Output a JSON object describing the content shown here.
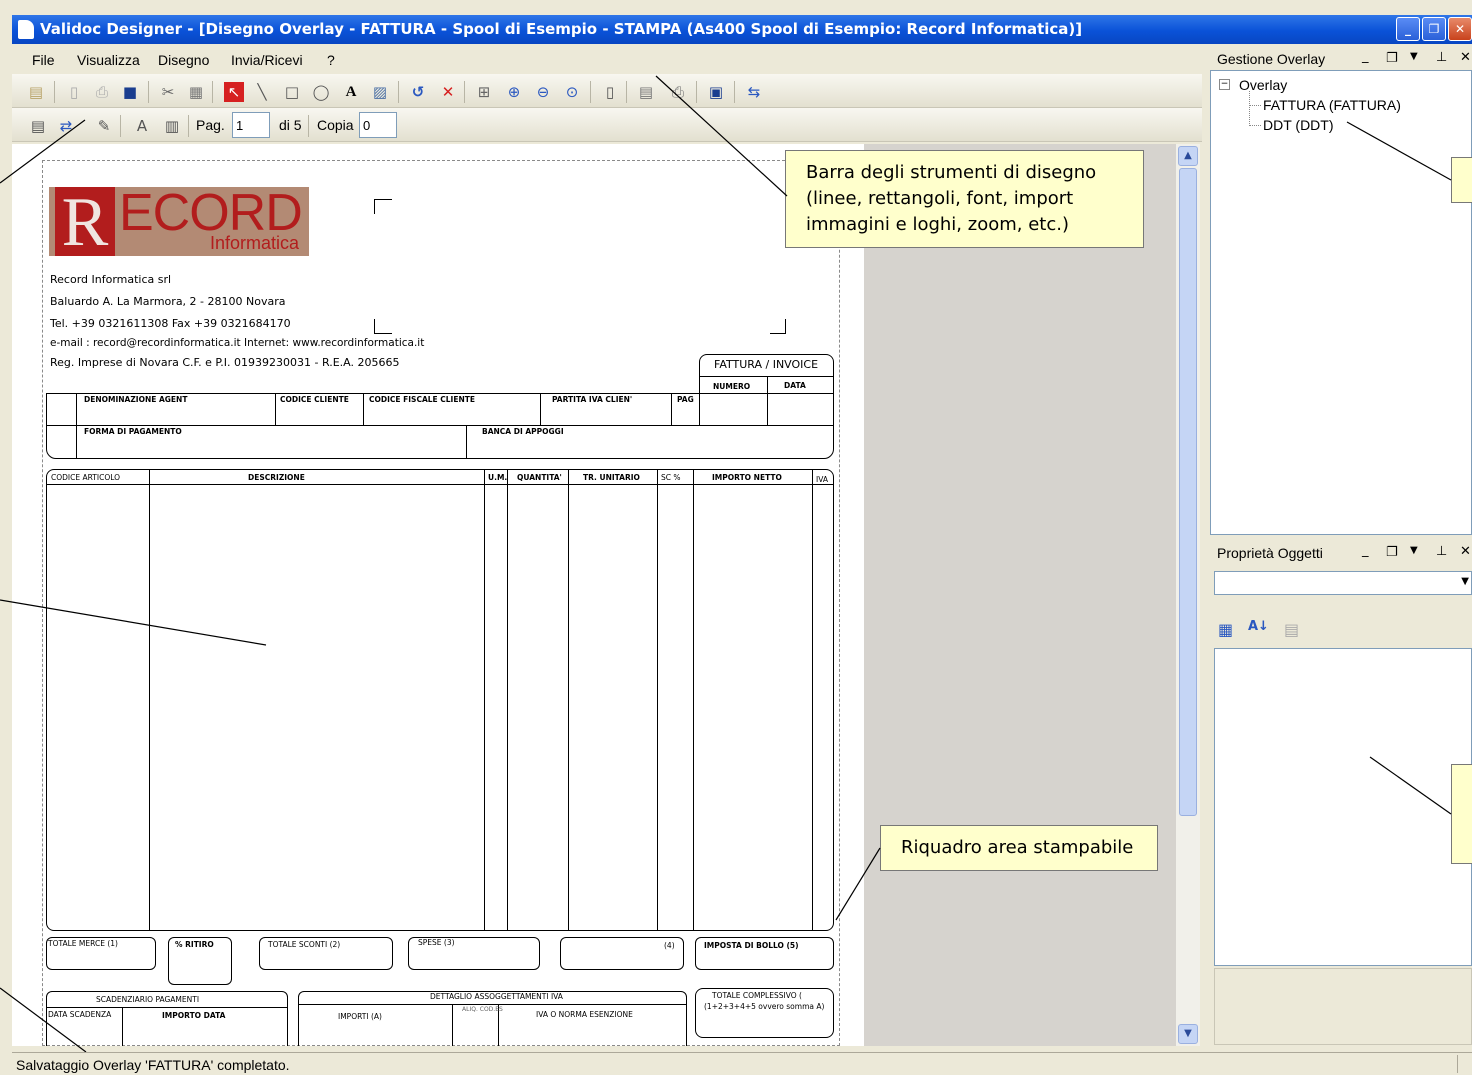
{
  "window": {
    "title": "Validoc Designer - [Disegno Overlay - FATTURA - Spool di Esempio - STAMPA (As400 Spool di Esempio: Record Informatica)]"
  },
  "menu": [
    "File",
    "Visualizza",
    "Disegno",
    "Invia/Ricevi",
    "?"
  ],
  "toolbar2": {
    "page_label": "Pag.",
    "page_value": "1",
    "of_label": "di 5",
    "copy_label": "Copia",
    "copy_value": "0"
  },
  "document": {
    "logo_r": "R",
    "logo_main": "ECORD",
    "logo_sub": "Informatica",
    "address": [
      "Record Informatica srl",
      "Baluardo A. La Marmora, 2 - 28100 Novara",
      "Tel. +39 0321611308 Fax +39 0321684170",
      "e-mail : record@recordinformatica.it Internet: www.recordinformatica.it",
      "Reg. Imprese di Novara C.F. e P.I. 01939230031 - R.E.A. 205665"
    ],
    "invoice_title": "FATTURA / INVOICE",
    "numero": "NUMERO",
    "data": "DATA",
    "denominazione": "DENOMINAZIONE AGENT",
    "codice_cliente": "CODICE CLIENTE",
    "codice_fiscale": "CODICE FISCALE CLIENTE",
    "partita_iva": "PARTITA IVA CLIEN'",
    "pag": "PAG",
    "forma_pagamento": "FORMA DI PAGAMENTO",
    "banca": "BANCA DI APPOGGI",
    "cols": [
      "CODICE ARTICOLO",
      "DESCRIZIONE",
      "U.M.",
      "QUANTITA'",
      "TR. UNITARIO",
      "SC %",
      "IMPORTO NETTO",
      "IVA"
    ],
    "totale_merce": "TOTALE MERCE (1)",
    "ritiro": "% RITIRO",
    "totale_sconti": "TOTALE SCONTI (2)",
    "spese": "SPESE (3)",
    "quattro": "(4)",
    "imposta_bollo": "IMPOSTA DI BOLLO (5)",
    "scadenziario": "SCADENZIARIO PAGAMENTI",
    "data_scadenza": "DATA SCADENZA",
    "importo_data": "IMPORTO DATA",
    "dettaglio": "DETTAGLIO ASSOGGETTAMENTI IVA",
    "importi": "IMPORTI (A)",
    "aliq": "ALIQ. COD.ES",
    "iva_norma": "IVA O NORMA ESENZIONE",
    "totale_complessivo": "TOTALE COMPLESSIVO (",
    "formula": "(1+2+3+4+5 ovvero somma A)"
  },
  "callouts": {
    "drawing_toolbar": "Barra degli strumenti  di disegno (linee, rettangoli, font, import immagini e loghi, zoom, etc.)",
    "print_area": "Riquadro area stampabile"
  },
  "panels": {
    "overlay_title": "Gestione Overlay",
    "tree_root": "Overlay",
    "tree_items": [
      "FATTURA (FATTURA)",
      "DDT (DDT)"
    ],
    "props_title": "Proprietà Oggetti"
  },
  "status": "Salvataggio Overlay 'FATTURA' completato."
}
